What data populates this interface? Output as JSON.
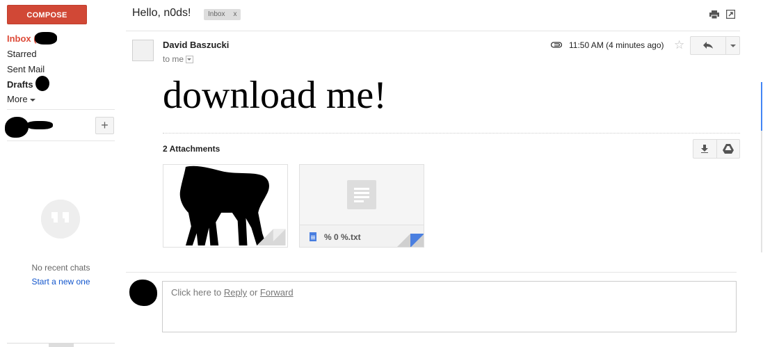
{
  "sidebar": {
    "compose_label": "COMPOSE",
    "nav": {
      "inbox": "Inbox (",
      "starred": "Starred",
      "sent": "Sent Mail",
      "drafts": "Drafts",
      "more": "More"
    },
    "plus_label": "+",
    "hangouts": {
      "no_chats": "No recent chats",
      "start_new": "Start a new one"
    }
  },
  "header": {
    "subject": "Hello, n0ds!",
    "label": "Inbox",
    "label_close": "x"
  },
  "message": {
    "sender": "David Baszucki",
    "recipient": "to me",
    "timestamp": "11:50 AM (4 minutes ago)",
    "body": "download me!",
    "attachments_title": "2 Attachments",
    "attachments": [
      {
        "name": "",
        "type": "image"
      },
      {
        "name": "% 0 %.txt",
        "type": "text"
      }
    ]
  },
  "reply_box": {
    "prefix": "Click here to ",
    "reply": "Reply",
    "or": " or ",
    "forward": "Forward"
  },
  "colors": {
    "compose_bg": "#d14836",
    "inbox_text": "#dd4b39",
    "link": "#1155cc",
    "file_icon": "#4a7fe0"
  },
  "icons": [
    "print-icon",
    "popout-icon",
    "paperclip-icon",
    "star-icon",
    "reply-icon",
    "download-icon",
    "drive-icon",
    "hangouts-quote-icon",
    "text-file-icon"
  ]
}
